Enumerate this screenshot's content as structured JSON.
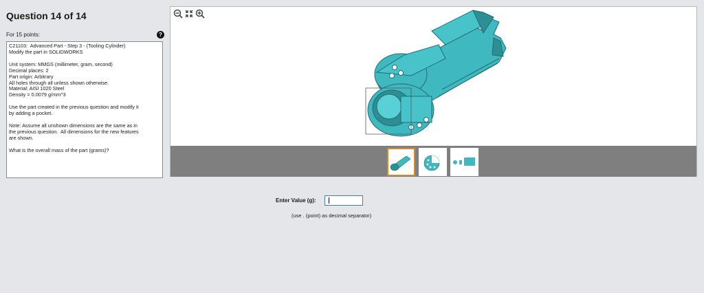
{
  "question": {
    "title": "Question 14 of 14",
    "points": "For 15 points:",
    "help_glyph": "?",
    "lines": [
      "C21103:  Advanced Part - Step 3 - (Tooling Cylinder)",
      "Modify the part in SOLIDWORKS",
      "",
      "Unit system: MMGS (millimeter, gram, second)",
      "Decimal places: 2",
      "Part origin: Arbitrary",
      "All holes through all unless shown otherwise.",
      "Material: AISI 1020 Steel",
      "Density = 0.0079 g/mm^3",
      "",
      "Use the part created in the previous question and modify it",
      "by adding a pocket.",
      "",
      "Note: Assume all unshown dimensions are the same as in",
      "the previous question.  All dimensions for the new features",
      "are shown.",
      "",
      "What is the overall mass of the part (grams)?"
    ]
  },
  "viewer": {
    "tools": [
      "zoom-out-icon",
      "fit-to-window-icon",
      "zoom-in-icon"
    ],
    "model_color": "#3fb8bf",
    "thumbnails": [
      {
        "name": "isometric-view",
        "active": true
      },
      {
        "name": "front-view",
        "active": false
      },
      {
        "name": "side-views",
        "active": false
      }
    ]
  },
  "answer": {
    "label": "Enter Value (g):",
    "value": "",
    "hint": "(use . (point) as decimal separator)"
  },
  "colors": {
    "background": "#e4e6e9",
    "thumb_strip": "#7f7f7f",
    "active_thumb_border": "#d98a2b",
    "input_border": "#4a7bb5"
  }
}
